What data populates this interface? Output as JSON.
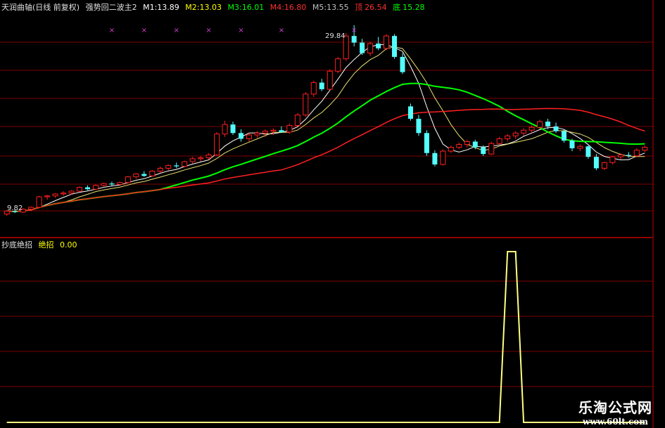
{
  "header": {
    "stock": "天润曲轴(日线 前复权)",
    "indicator": "强势回二波主2",
    "ma": [
      {
        "label": "M1:",
        "value": "13.89",
        "color": "#ffffff"
      },
      {
        "label": "M2:",
        "value": "13.03",
        "color": "#ffff00"
      },
      {
        "label": "M3:",
        "value": "16.01",
        "color": "#00ff00"
      },
      {
        "label": "M4:",
        "value": "16.80",
        "color": "#ff0000"
      },
      {
        "label": "M5:",
        "value": "13.55",
        "color": "#c0c0c0"
      }
    ],
    "top_label": "顶",
    "top_value": "26.54",
    "bottom_label": "底",
    "bottom_value": "15.28"
  },
  "sub_header": {
    "title": "抄底绝招",
    "name": "绝招",
    "value": "0.00"
  },
  "annotations": {
    "high": "29.84",
    "low": "9.82",
    "marker": "×"
  },
  "watermark": {
    "title": "乐淘公式网",
    "url": "www.60lt.com"
  },
  "colors": {
    "up": "#ff2020",
    "down": "#54ffff",
    "grid": "#800000",
    "signal": "#ffff80"
  },
  "chart_data": [
    {
      "type": "candlestick",
      "x_count": 80,
      "ylim": [
        9,
        31
      ],
      "candles": [
        [
          10.0,
          10.4,
          9.8,
          10.3
        ],
        [
          10.3,
          10.5,
          10.1,
          10.2
        ],
        [
          10.2,
          10.6,
          10.1,
          10.5
        ],
        [
          10.5,
          10.8,
          10.3,
          10.7
        ],
        [
          10.7,
          11.9,
          10.6,
          11.8
        ],
        [
          11.8,
          12.0,
          11.5,
          11.9
        ],
        [
          11.9,
          12.2,
          11.7,
          12.1
        ],
        [
          12.1,
          12.4,
          11.9,
          12.2
        ],
        [
          12.2,
          12.5,
          12.0,
          12.4
        ],
        [
          12.4,
          12.9,
          12.3,
          12.8
        ],
        [
          12.8,
          13.0,
          12.5,
          12.6
        ],
        [
          12.6,
          13.1,
          12.5,
          13.0
        ],
        [
          13.0,
          13.3,
          12.8,
          13.2
        ],
        [
          13.2,
          13.4,
          12.9,
          13.1
        ],
        [
          13.1,
          13.4,
          13.0,
          13.3
        ],
        [
          13.3,
          14.0,
          13.2,
          13.9
        ],
        [
          13.9,
          14.3,
          13.7,
          14.2
        ],
        [
          14.2,
          14.5,
          13.9,
          14.0
        ],
        [
          14.0,
          14.6,
          13.9,
          14.5
        ],
        [
          14.5,
          15.0,
          14.3,
          14.8
        ],
        [
          14.8,
          15.2,
          14.6,
          15.1
        ],
        [
          15.1,
          15.4,
          14.8,
          15.0
        ],
        [
          15.0,
          15.6,
          14.9,
          15.5
        ],
        [
          15.5,
          16.0,
          15.3,
          15.8
        ],
        [
          15.8,
          16.1,
          15.5,
          15.9
        ],
        [
          15.9,
          16.4,
          15.7,
          16.2
        ],
        [
          16.2,
          18.6,
          16.1,
          18.4
        ],
        [
          18.4,
          19.8,
          18.1,
          19.4
        ],
        [
          19.4,
          19.7,
          18.3,
          18.5
        ],
        [
          18.5,
          18.9,
          17.6,
          17.9
        ],
        [
          17.9,
          18.5,
          17.6,
          18.3
        ],
        [
          18.3,
          18.7,
          18.0,
          18.5
        ],
        [
          18.5,
          18.9,
          18.1,
          18.7
        ],
        [
          18.7,
          19.0,
          18.3,
          18.8
        ],
        [
          18.8,
          19.2,
          18.5,
          18.6
        ],
        [
          18.6,
          19.5,
          18.4,
          19.3
        ],
        [
          19.3,
          20.6,
          19.2,
          20.4
        ],
        [
          20.4,
          22.8,
          20.2,
          22.6
        ],
        [
          22.6,
          24.0,
          22.3,
          23.8
        ],
        [
          23.8,
          24.2,
          22.9,
          23.1
        ],
        [
          23.1,
          25.2,
          23.0,
          25.0
        ],
        [
          25.0,
          26.5,
          24.8,
          26.3
        ],
        [
          26.3,
          29.0,
          26.1,
          28.7
        ],
        [
          28.7,
          29.84,
          27.6,
          28.0
        ],
        [
          28.0,
          28.4,
          26.7,
          26.9
        ],
        [
          26.9,
          28.1,
          26.6,
          27.9
        ],
        [
          27.9,
          28.6,
          27.2,
          27.4
        ],
        [
          27.4,
          28.9,
          27.2,
          28.7
        ],
        [
          28.7,
          28.9,
          26.3,
          26.5
        ],
        [
          26.5,
          26.9,
          24.7,
          24.9
        ],
        [
          21.3,
          21.6,
          19.8,
          20.0
        ],
        [
          20.0,
          20.4,
          18.2,
          18.5
        ],
        [
          18.5,
          18.8,
          16.1,
          16.4
        ],
        [
          16.4,
          16.7,
          15.0,
          15.2
        ],
        [
          15.2,
          16.8,
          15.1,
          16.6
        ],
        [
          16.6,
          17.2,
          16.4,
          17.0
        ],
        [
          17.0,
          17.5,
          16.8,
          17.3
        ],
        [
          17.3,
          17.8,
          17.0,
          17.6
        ],
        [
          17.6,
          17.8,
          16.8,
          17.0
        ],
        [
          17.0,
          17.2,
          16.1,
          16.3
        ],
        [
          16.3,
          17.6,
          16.2,
          17.4
        ],
        [
          17.4,
          18.1,
          17.2,
          17.9
        ],
        [
          17.9,
          18.4,
          17.6,
          18.2
        ],
        [
          18.2,
          18.7,
          17.9,
          18.5
        ],
        [
          18.5,
          19.0,
          18.2,
          18.8
        ],
        [
          18.8,
          19.3,
          18.5,
          19.1
        ],
        [
          19.1,
          19.9,
          18.9,
          19.7
        ],
        [
          19.7,
          20.0,
          18.9,
          19.2
        ],
        [
          19.2,
          19.6,
          18.5,
          18.7
        ],
        [
          18.7,
          18.9,
          17.5,
          17.7
        ],
        [
          17.7,
          17.9,
          16.6,
          16.9
        ],
        [
          16.9,
          17.3,
          16.6,
          17.1
        ],
        [
          17.1,
          17.2,
          15.8,
          16.0
        ],
        [
          16.0,
          16.3,
          14.6,
          14.8
        ],
        [
          14.8,
          15.5,
          14.6,
          15.4
        ],
        [
          15.4,
          16.1,
          15.2,
          16.0
        ],
        [
          16.0,
          16.4,
          15.7,
          16.2
        ],
        [
          16.2,
          16.5,
          15.9,
          16.1
        ],
        [
          16.1,
          16.9,
          16.0,
          16.7
        ],
        [
          16.7,
          17.2,
          16.5,
          17.0
        ]
      ],
      "sub_ylim": [
        0,
        1
      ],
      "signal": [
        0,
        0,
        0,
        0,
        0,
        0,
        0,
        0,
        0,
        0,
        0,
        0,
        0,
        0,
        0,
        0,
        0,
        0,
        0,
        0,
        0,
        0,
        0,
        0,
        0,
        0,
        0,
        0,
        0,
        0,
        0,
        0,
        0,
        0,
        0,
        0,
        0,
        0,
        0,
        0,
        0,
        0,
        0,
        0,
        0,
        0,
        0,
        0,
        0,
        0,
        0,
        0,
        0,
        0,
        0,
        0,
        0,
        0,
        0,
        0,
        0,
        0,
        1,
        1,
        0,
        0,
        0,
        0,
        0,
        0,
        0,
        0,
        0,
        0,
        0,
        0,
        0,
        0,
        0,
        0
      ],
      "signal_hit": [
        53,
        73
      ]
    }
  ]
}
